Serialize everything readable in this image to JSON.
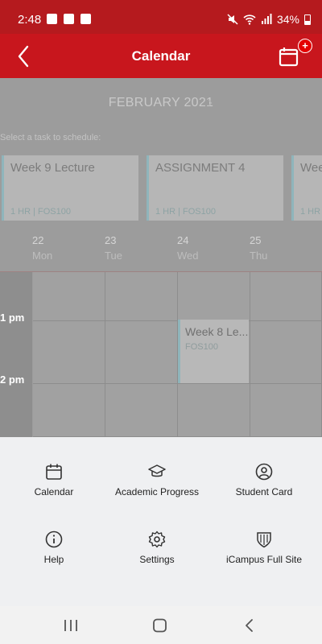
{
  "status_bar": {
    "time": "2:48",
    "battery": "34%"
  },
  "app_bar": {
    "title": "Calendar",
    "badge": "+"
  },
  "calendar": {
    "month": "FEBRUARY 2021",
    "prompt": "Select a task to schedule:",
    "tasks": [
      {
        "title": "Week 9 Lecture",
        "meta": "1 HR | FOS100"
      },
      {
        "title": "ASSIGNMENT 4",
        "meta": "1 HR | FOS100"
      },
      {
        "title": "Wee",
        "meta": "1 HR"
      }
    ],
    "days": [
      {
        "num": "22",
        "name": "Mon"
      },
      {
        "num": "23",
        "name": "Tue"
      },
      {
        "num": "24",
        "name": "Wed"
      },
      {
        "num": "25",
        "name": "Thu"
      }
    ],
    "times": [
      "1 pm",
      "2 pm"
    ],
    "event": {
      "title": "Week 8 Le...",
      "course": "FOS100"
    }
  },
  "menu": {
    "items": [
      {
        "label": "Calendar",
        "icon": "calendar-icon"
      },
      {
        "label": "Academic Progress",
        "icon": "graduation-cap-icon"
      },
      {
        "label": "Student Card",
        "icon": "user-circle-icon"
      },
      {
        "label": "Help",
        "icon": "info-icon"
      },
      {
        "label": "Settings",
        "icon": "gear-icon"
      },
      {
        "label": "iCampus Full Site",
        "icon": "shield-icon"
      }
    ]
  },
  "colors": {
    "brand_red": "#c8161d",
    "status_red": "#b51a1e",
    "task_accent": "#8fb5bb"
  }
}
